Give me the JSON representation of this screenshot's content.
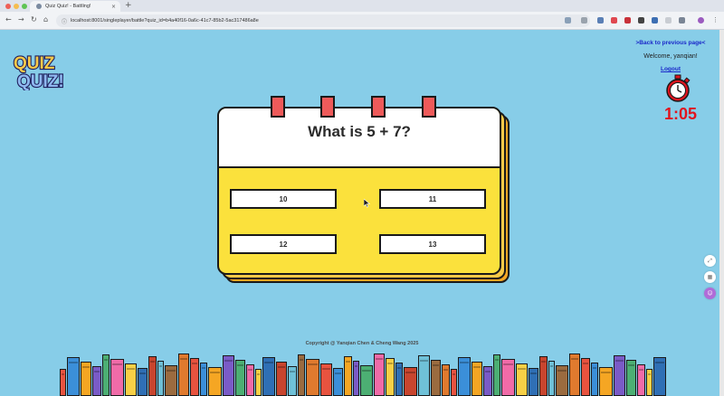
{
  "browser": {
    "tab_title": "Quiz Quiz! - Battling!",
    "tab_close": "×",
    "new_tab": "+",
    "url": "localhost:8001/singleplayer/battle?quiz_id=b4a40f16-0a6c-41c7-85b2-5ac317486a8e",
    "traffic_colors": [
      "#ee5f57",
      "#f5bd4f",
      "#5fc454"
    ],
    "nav": {
      "back": "←",
      "forward": "→",
      "reload": "↻",
      "home": "⌂"
    }
  },
  "header": {
    "logo_text": "QUIZ QUIZ!",
    "back_link": ">Back to previous page<",
    "welcome": "Welcome, yanqian!",
    "logout": "Logout"
  },
  "timer": {
    "icon": "stopwatch-icon",
    "value": "1:05"
  },
  "quiz": {
    "question": "What is 5 + 7?",
    "answers": [
      "10",
      "11",
      "12",
      "13"
    ]
  },
  "side_tools": [
    "expand-icon",
    "qr-icon",
    "translate-icon"
  ],
  "footer": {
    "copyright": "Copyright @ Yanqian Chen & Cheng Wang 2025"
  },
  "colors": {
    "background": "#87cde8",
    "card_yellow": "#fbe13c",
    "ring_red": "#ee5a5a",
    "timer_red": "#e0141e",
    "link_blue": "#1a28c9"
  }
}
